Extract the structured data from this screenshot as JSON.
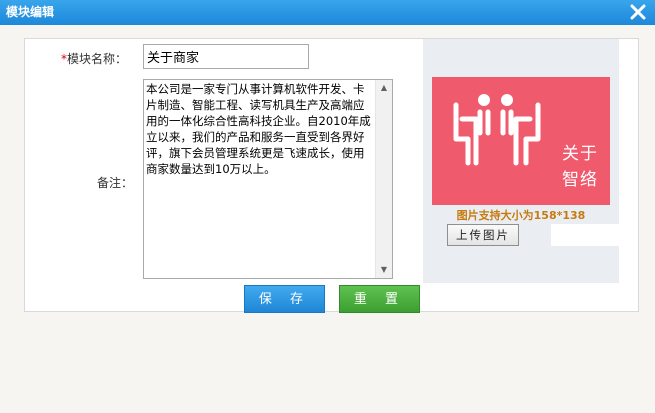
{
  "window": {
    "title": "模块编辑",
    "close_icon": "close-icon"
  },
  "form": {
    "name_label": "模块名称：",
    "name_required_mark": "*",
    "name_value": "关于商家",
    "remark_label": "备注：",
    "remark_value": "本公司是一家专门从事计算机软件开发、卡片制造、智能工程、读写机具生产及高端应用的一体化综合性高科技企业。自2010年成立以来，我们的产品和服务一直受到各界好评，旗下会员管理系统更是飞速成长，使用商家数量达到10万以上。"
  },
  "image_panel": {
    "logo_text_line1": "关于",
    "logo_text_line2": "智络",
    "logo_color": "#f05a6d",
    "size_hint": "图片支持大小为158*138",
    "upload_label": "上传图片"
  },
  "buttons": {
    "save": "保 存",
    "reset": "重 置"
  },
  "colors": {
    "titlebar": "#2596e2",
    "save": "#2a92df",
    "reset": "#4cb23f",
    "hint": "#c67b12"
  }
}
